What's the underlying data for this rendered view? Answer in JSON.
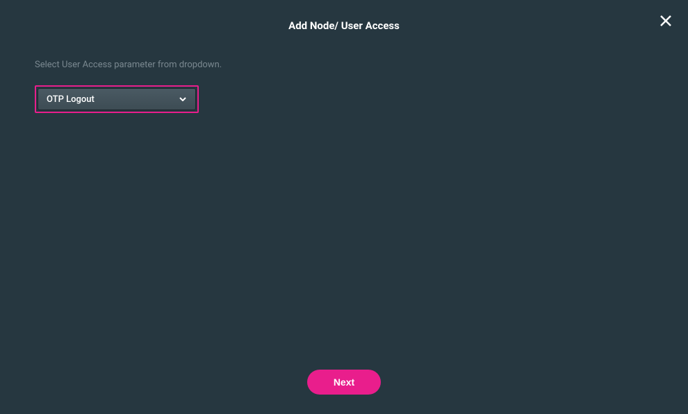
{
  "modal": {
    "title": "Add Node/ User Access",
    "instruction": "Select User Access parameter from dropdown.",
    "dropdown": {
      "selected": "OTP Logout"
    },
    "footer": {
      "next_label": "Next"
    }
  }
}
